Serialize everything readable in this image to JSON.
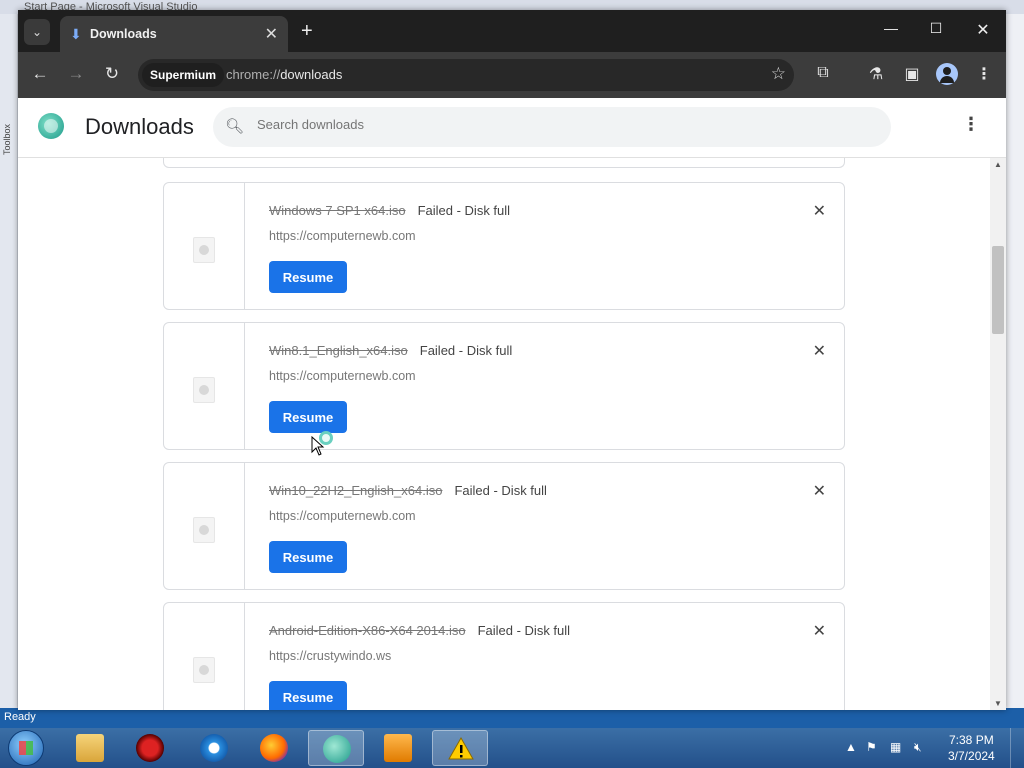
{
  "vs": {
    "title": "Start Page - Microsoft Visual Studio",
    "toolbox": "Toolbox",
    "status": "Ready"
  },
  "browser": {
    "tab_title": "Downloads",
    "chip": "Supermium",
    "url_scheme": "chrome://",
    "url_path": "downloads"
  },
  "page": {
    "title": "Downloads",
    "search_placeholder": "Search downloads"
  },
  "downloads": [
    {
      "name": "Windows 7 SP1 x64.iso",
      "status": "Failed - Disk full",
      "url": "https://computernewb.com",
      "action": "Resume"
    },
    {
      "name": "Win8.1_English_x64.iso",
      "status": "Failed - Disk full",
      "url": "https://computernewb.com",
      "action": "Resume"
    },
    {
      "name": "Win10_22H2_English_x64.iso",
      "status": "Failed - Disk full",
      "url": "https://computernewb.com",
      "action": "Resume"
    },
    {
      "name": "Android-Edition-X86-X64 2014.iso",
      "status": "Failed - Disk full",
      "url": "https://crustywindo.ws",
      "action": "Resume"
    }
  ],
  "taskbar": {
    "time": "7:38 PM",
    "date": "3/7/2024"
  },
  "colors": {
    "accent": "#1a73e8",
    "tabbar": "#1f1f1f",
    "toolbar": "#3c3c3c"
  }
}
